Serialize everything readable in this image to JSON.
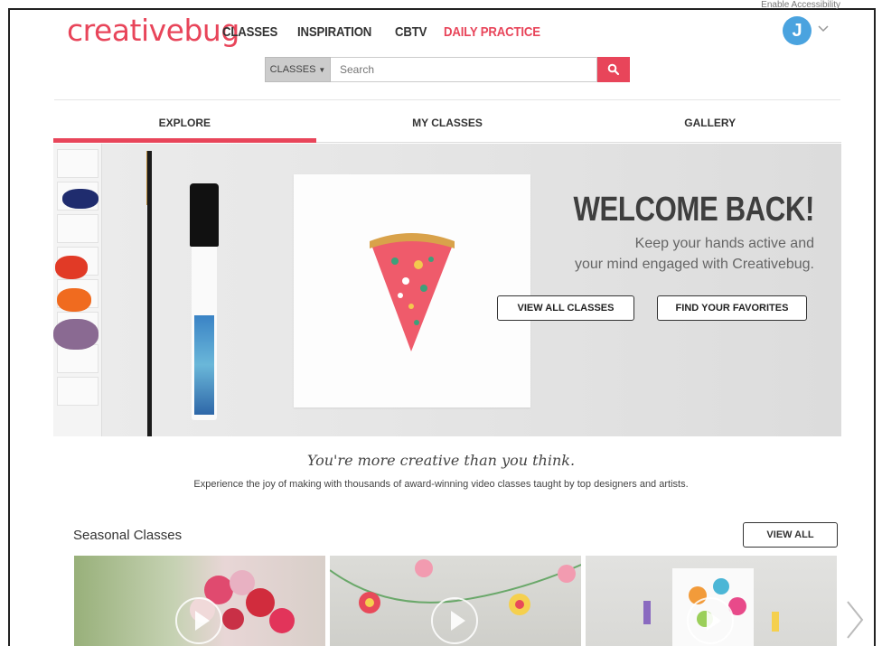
{
  "header": {
    "logo": "creativebug",
    "nav": [
      "CLASSES",
      "INSPIRATION",
      "CBTV",
      "DAILY PRACTICE"
    ],
    "accessibility_link": "Enable Accessibility",
    "avatar_initial": "J"
  },
  "search": {
    "category": "CLASSES",
    "placeholder": "Search"
  },
  "tabs": [
    {
      "label": "EXPLORE",
      "active": true
    },
    {
      "label": "MY CLASSES",
      "active": false
    },
    {
      "label": "GALLERY",
      "active": false
    }
  ],
  "hero": {
    "title": "WELCOME BACK!",
    "subtitle_line1": "Keep your hands active and",
    "subtitle_line2": "your mind engaged with Creativebug.",
    "button_all": "VIEW ALL CLASSES",
    "button_fav": "FIND YOUR FAVORITES"
  },
  "tagline": "You're more creative than you think.",
  "subline": "Experience the joy of making with thousands of award-winning video classes taught by top designers and artists.",
  "seasonal": {
    "title": "Seasonal Classes",
    "view_all": "VIEW ALL"
  },
  "colors": {
    "brand": "#e8455a",
    "avatar": "#4aa3df"
  }
}
